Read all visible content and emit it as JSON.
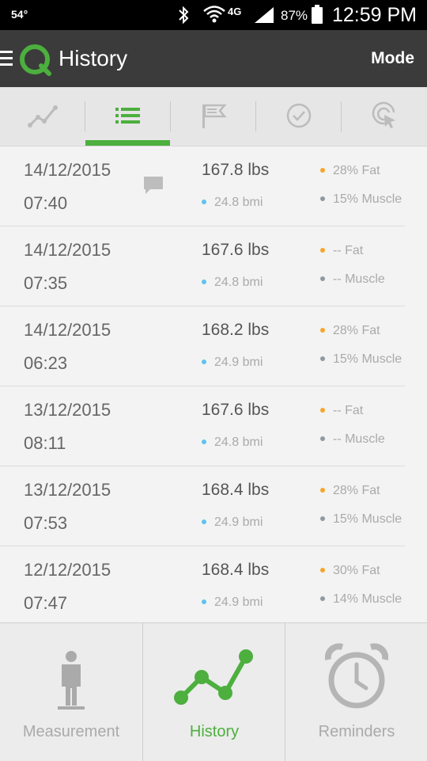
{
  "status_bar": {
    "temperature": "54°",
    "network": "4G",
    "battery_percent": "87%",
    "time": "12:59 PM"
  },
  "app_bar": {
    "title": "History",
    "mode_label": "Mode"
  },
  "tabs": [
    {
      "icon": "line-chart-icon",
      "active": false
    },
    {
      "icon": "list-icon",
      "active": true
    },
    {
      "icon": "flag-icon",
      "active": false
    },
    {
      "icon": "check-circle-icon",
      "active": false
    },
    {
      "icon": "target-icon",
      "active": false
    }
  ],
  "history": [
    {
      "date": "14/12/2015",
      "time": "07:40",
      "weight": "167.8 lbs",
      "bmi": "24.8 bmi",
      "fat": "28% Fat",
      "muscle": "15% Muscle",
      "has_note": true
    },
    {
      "date": "14/12/2015",
      "time": "07:35",
      "weight": "167.6 lbs",
      "bmi": "24.8 bmi",
      "fat": "-- Fat",
      "muscle": "-- Muscle",
      "has_note": false
    },
    {
      "date": "14/12/2015",
      "time": "06:23",
      "weight": "168.2 lbs",
      "bmi": "24.9 bmi",
      "fat": "28% Fat",
      "muscle": "15% Muscle",
      "has_note": false
    },
    {
      "date": "13/12/2015",
      "time": "08:11",
      "weight": "167.6 lbs",
      "bmi": "24.8 bmi",
      "fat": "-- Fat",
      "muscle": "-- Muscle",
      "has_note": false
    },
    {
      "date": "13/12/2015",
      "time": "07:53",
      "weight": "168.4 lbs",
      "bmi": "24.9 bmi",
      "fat": "28% Fat",
      "muscle": "15% Muscle",
      "has_note": false
    },
    {
      "date": "12/12/2015",
      "time": "07:47",
      "weight": "168.4 lbs",
      "bmi": "24.9 bmi",
      "fat": "30% Fat",
      "muscle": "14% Muscle",
      "has_note": false
    }
  ],
  "bottom_nav": [
    {
      "label": "Measurement",
      "icon": "person-icon",
      "active": false
    },
    {
      "label": "History",
      "icon": "trend-chart-icon",
      "active": true
    },
    {
      "label": "Reminders",
      "icon": "alarm-clock-icon",
      "active": false
    }
  ],
  "colors": {
    "accent": "#4caf3e",
    "app_bar": "#3b3b3b",
    "bmi_dot": "#5ec3ee",
    "fat_dot": "#f7a52a",
    "muscle_dot": "#8f99a3"
  }
}
